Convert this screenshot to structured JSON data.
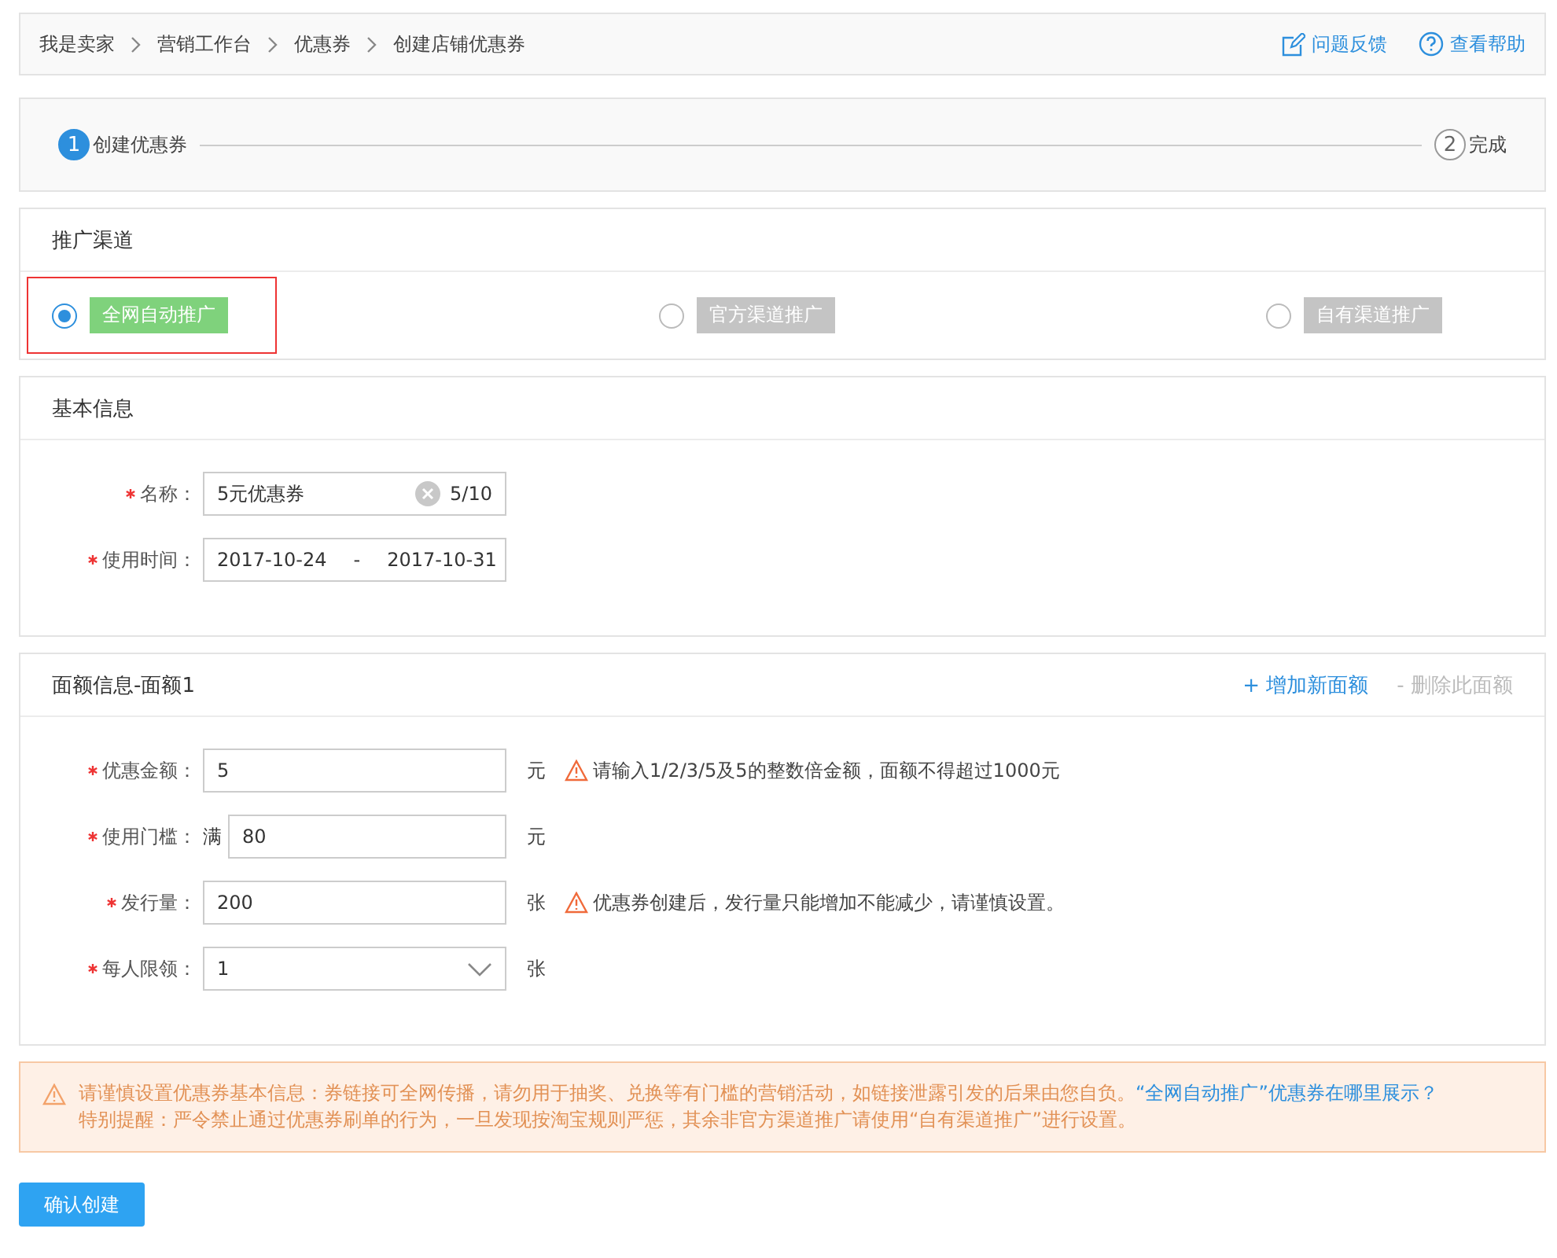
{
  "breadcrumb": {
    "items": [
      {
        "label": "我是卖家"
      },
      {
        "label": "营销工作台"
      },
      {
        "label": "优惠券"
      },
      {
        "label": "创建店铺优惠券"
      }
    ],
    "links": [
      {
        "label": "问题反馈",
        "kind": "feedback"
      },
      {
        "label": "查看帮助",
        "kind": "help"
      }
    ]
  },
  "steps": [
    {
      "number": "1",
      "label": "创建优惠券",
      "active": true
    },
    {
      "number": "2",
      "label": "完成",
      "active": false
    }
  ],
  "channel": {
    "title": "推广渠道",
    "options": [
      {
        "label": "全网自动推广",
        "selected": true,
        "highlighted": true
      },
      {
        "label": "官方渠道推广",
        "selected": false,
        "highlighted": false
      },
      {
        "label": "自有渠道推广",
        "selected": false,
        "highlighted": false
      }
    ]
  },
  "basic_info": {
    "title": "基本信息",
    "fields": [
      {
        "kind": "text",
        "label": "名称：",
        "required": true,
        "value": "5元优惠券",
        "counter": "5/10"
      },
      {
        "kind": "daterange",
        "label": "使用时间：",
        "required": true,
        "start": "2017-10-24",
        "separator": "-",
        "end": "2017-10-31"
      }
    ]
  },
  "face_value": {
    "title": "面额信息-面额1",
    "actions": [
      {
        "label": "+ 增加新面额",
        "disabled": false
      },
      {
        "label": "- 删除此面额",
        "disabled": true
      }
    ],
    "fields": [
      {
        "kind": "input",
        "label": "优惠金额：",
        "required": true,
        "value": "5",
        "unit": "元",
        "hint": "请输入1/2/3/5及5的整数倍金额，面额不得超过1000元"
      },
      {
        "kind": "input",
        "label": "使用门槛：",
        "required": true,
        "prefix": "满",
        "value": "80",
        "unit": "元"
      },
      {
        "kind": "input",
        "label": "发行量：",
        "required": true,
        "value": "200",
        "unit": "张",
        "hint": "优惠券创建后，发行量只能增加不能减少，请谨慎设置。"
      },
      {
        "kind": "select",
        "label": "每人限领：",
        "required": true,
        "value": "1",
        "unit": "张"
      }
    ]
  },
  "notice": {
    "line_1": "请谨慎设置优惠券基本信息：券链接可全网传播，请勿用于抽奖、兑换等有门槛的营销活动，如链接泄露引发的后果由您自负。",
    "link": "“全网自动推广”优惠券在哪里展示？",
    "line_2": "特别提醒：严令禁止通过优惠券刷单的行为，一旦发现按淘宝规则严惩，其余非官方渠道推广请使用“自有渠道推广”进行设置。"
  },
  "submit_button": "确认创建"
}
